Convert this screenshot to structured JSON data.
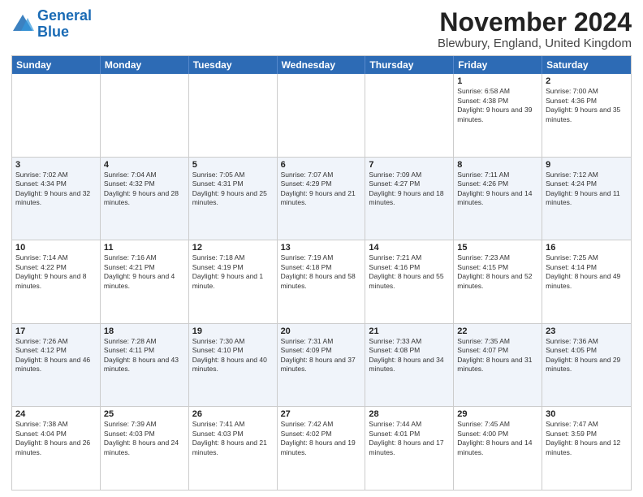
{
  "logo": {
    "line1": "General",
    "line2": "Blue"
  },
  "header": {
    "month": "November 2024",
    "location": "Blewbury, England, United Kingdom"
  },
  "weekdays": [
    "Sunday",
    "Monday",
    "Tuesday",
    "Wednesday",
    "Thursday",
    "Friday",
    "Saturday"
  ],
  "rows": [
    {
      "alt": false,
      "cells": [
        {
          "day": "",
          "info": ""
        },
        {
          "day": "",
          "info": ""
        },
        {
          "day": "",
          "info": ""
        },
        {
          "day": "",
          "info": ""
        },
        {
          "day": "",
          "info": ""
        },
        {
          "day": "1",
          "info": "Sunrise: 6:58 AM\nSunset: 4:38 PM\nDaylight: 9 hours and 39 minutes."
        },
        {
          "day": "2",
          "info": "Sunrise: 7:00 AM\nSunset: 4:36 PM\nDaylight: 9 hours and 35 minutes."
        }
      ]
    },
    {
      "alt": true,
      "cells": [
        {
          "day": "3",
          "info": "Sunrise: 7:02 AM\nSunset: 4:34 PM\nDaylight: 9 hours and 32 minutes."
        },
        {
          "day": "4",
          "info": "Sunrise: 7:04 AM\nSunset: 4:32 PM\nDaylight: 9 hours and 28 minutes."
        },
        {
          "day": "5",
          "info": "Sunrise: 7:05 AM\nSunset: 4:31 PM\nDaylight: 9 hours and 25 minutes."
        },
        {
          "day": "6",
          "info": "Sunrise: 7:07 AM\nSunset: 4:29 PM\nDaylight: 9 hours and 21 minutes."
        },
        {
          "day": "7",
          "info": "Sunrise: 7:09 AM\nSunset: 4:27 PM\nDaylight: 9 hours and 18 minutes."
        },
        {
          "day": "8",
          "info": "Sunrise: 7:11 AM\nSunset: 4:26 PM\nDaylight: 9 hours and 14 minutes."
        },
        {
          "day": "9",
          "info": "Sunrise: 7:12 AM\nSunset: 4:24 PM\nDaylight: 9 hours and 11 minutes."
        }
      ]
    },
    {
      "alt": false,
      "cells": [
        {
          "day": "10",
          "info": "Sunrise: 7:14 AM\nSunset: 4:22 PM\nDaylight: 9 hours and 8 minutes."
        },
        {
          "day": "11",
          "info": "Sunrise: 7:16 AM\nSunset: 4:21 PM\nDaylight: 9 hours and 4 minutes."
        },
        {
          "day": "12",
          "info": "Sunrise: 7:18 AM\nSunset: 4:19 PM\nDaylight: 9 hours and 1 minute."
        },
        {
          "day": "13",
          "info": "Sunrise: 7:19 AM\nSunset: 4:18 PM\nDaylight: 8 hours and 58 minutes."
        },
        {
          "day": "14",
          "info": "Sunrise: 7:21 AM\nSunset: 4:16 PM\nDaylight: 8 hours and 55 minutes."
        },
        {
          "day": "15",
          "info": "Sunrise: 7:23 AM\nSunset: 4:15 PM\nDaylight: 8 hours and 52 minutes."
        },
        {
          "day": "16",
          "info": "Sunrise: 7:25 AM\nSunset: 4:14 PM\nDaylight: 8 hours and 49 minutes."
        }
      ]
    },
    {
      "alt": true,
      "cells": [
        {
          "day": "17",
          "info": "Sunrise: 7:26 AM\nSunset: 4:12 PM\nDaylight: 8 hours and 46 minutes."
        },
        {
          "day": "18",
          "info": "Sunrise: 7:28 AM\nSunset: 4:11 PM\nDaylight: 8 hours and 43 minutes."
        },
        {
          "day": "19",
          "info": "Sunrise: 7:30 AM\nSunset: 4:10 PM\nDaylight: 8 hours and 40 minutes."
        },
        {
          "day": "20",
          "info": "Sunrise: 7:31 AM\nSunset: 4:09 PM\nDaylight: 8 hours and 37 minutes."
        },
        {
          "day": "21",
          "info": "Sunrise: 7:33 AM\nSunset: 4:08 PM\nDaylight: 8 hours and 34 minutes."
        },
        {
          "day": "22",
          "info": "Sunrise: 7:35 AM\nSunset: 4:07 PM\nDaylight: 8 hours and 31 minutes."
        },
        {
          "day": "23",
          "info": "Sunrise: 7:36 AM\nSunset: 4:05 PM\nDaylight: 8 hours and 29 minutes."
        }
      ]
    },
    {
      "alt": false,
      "cells": [
        {
          "day": "24",
          "info": "Sunrise: 7:38 AM\nSunset: 4:04 PM\nDaylight: 8 hours and 26 minutes."
        },
        {
          "day": "25",
          "info": "Sunrise: 7:39 AM\nSunset: 4:03 PM\nDaylight: 8 hours and 24 minutes."
        },
        {
          "day": "26",
          "info": "Sunrise: 7:41 AM\nSunset: 4:03 PM\nDaylight: 8 hours and 21 minutes."
        },
        {
          "day": "27",
          "info": "Sunrise: 7:42 AM\nSunset: 4:02 PM\nDaylight: 8 hours and 19 minutes."
        },
        {
          "day": "28",
          "info": "Sunrise: 7:44 AM\nSunset: 4:01 PM\nDaylight: 8 hours and 17 minutes."
        },
        {
          "day": "29",
          "info": "Sunrise: 7:45 AM\nSunset: 4:00 PM\nDaylight: 8 hours and 14 minutes."
        },
        {
          "day": "30",
          "info": "Sunrise: 7:47 AM\nSunset: 3:59 PM\nDaylight: 8 hours and 12 minutes."
        }
      ]
    }
  ]
}
